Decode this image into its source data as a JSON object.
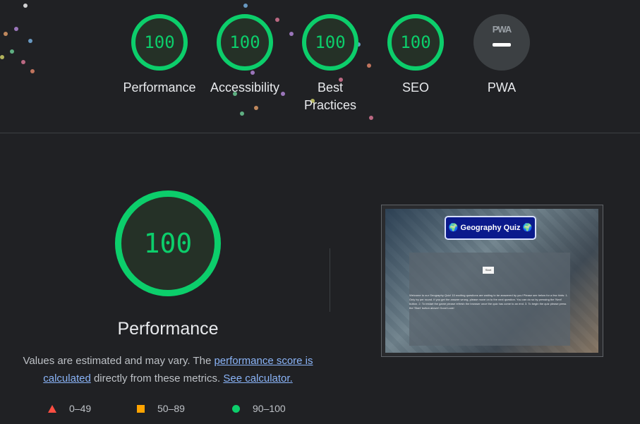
{
  "gauges": [
    {
      "score": "100",
      "label": "Performance"
    },
    {
      "score": "100",
      "label": "Accessibility"
    },
    {
      "score": "100",
      "label_line1": "Best",
      "label_line2": "Practices"
    },
    {
      "score": "100",
      "label": "SEO"
    }
  ],
  "pwa": {
    "badge": "PWA",
    "label": "PWA"
  },
  "main": {
    "score": "100",
    "title": "Performance",
    "desc_part1": "Values are estimated and may vary. The ",
    "desc_link1": "performance score is calculated",
    "desc_part2": " directly from these metrics. ",
    "desc_link2": "See calculator."
  },
  "legend": [
    {
      "range": "0–49",
      "color": "#ff4e42"
    },
    {
      "range": "50–89",
      "color": "#ffa400"
    },
    {
      "range": "90–100",
      "color": "#0cce6b"
    }
  ],
  "screenshot": {
    "title": "🌍 Geography Quiz 🌍",
    "button": "Start",
    "text": "Welcome to our Geography Quiz! 10 exciting questions are waiting to be answered by you! Please see below for a few hints: 1. Only try per round. If you get the answer wrong, please move on to the next question. You can do so by pressing the 'Next' button. 2. To restart the game please refresh the browser once the quiz has come to an end. 3. To begin the quiz please press the 'Start' button above! Good Luck!"
  },
  "colors": {
    "pass": "#0cce6b",
    "average": "#ffa400",
    "fail": "#ff4e42",
    "link": "#8ab4f8"
  }
}
